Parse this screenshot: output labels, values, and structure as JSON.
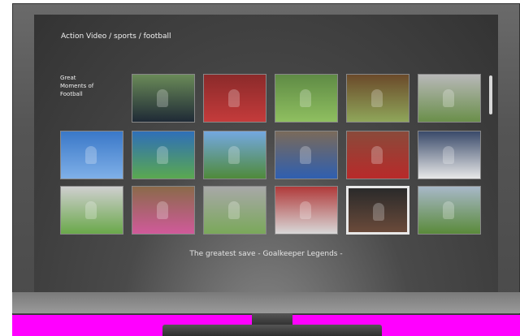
{
  "screen": {
    "breadcrumb": "Action Video / sports / football",
    "category_label": "Great\nMoments of\nFootball",
    "caption": "The greatest save - Goalkeeper Legends -"
  },
  "colors": {
    "pink_band": "#ff00ff",
    "bezel": "#555555"
  },
  "grid": {
    "selected_index": 15,
    "tiles": [
      {
        "icon": "stadium-crowd-photo",
        "top": "#6a8a58",
        "bottom": "#1f2a36"
      },
      {
        "icon": "team-celebration-red-photo",
        "top": "#8b2a2a",
        "bottom": "#c43b3b"
      },
      {
        "icon": "players-legs-field-photo",
        "top": "#5f8b45",
        "bottom": "#8fbf60"
      },
      {
        "icon": "slide-tackle-photo",
        "top": "#6b4a2a",
        "bottom": "#8fa65a"
      },
      {
        "icon": "stadium-stands-photo",
        "top": "#b8b8b8",
        "bottom": "#6a8f4a"
      },
      {
        "icon": "header-player-sky-photo",
        "top": "#3a78c8",
        "bottom": "#7fb0e8"
      },
      {
        "icon": "goalkeeper-green-dive-photo",
        "top": "#2f6fb8",
        "bottom": "#5aa850"
      },
      {
        "icon": "overhead-kick-sky-photo",
        "top": "#74a8e0",
        "bottom": "#4f8a3a"
      },
      {
        "icon": "goalkeeper-blue-jersey-photo",
        "top": "#7a6a5a",
        "bottom": "#2f5fb0"
      },
      {
        "icon": "two-players-red-black-photo",
        "top": "#8a4a3a",
        "bottom": "#b82a2a"
      },
      {
        "icon": "players-white-celebrate-photo",
        "top": "#3a4a6a",
        "bottom": "#e8e8e8"
      },
      {
        "icon": "player-running-pitch-photo",
        "top": "#cfcfcf",
        "bottom": "#6aa84a"
      },
      {
        "icon": "goalkeeper-pink-save-photo",
        "top": "#8a6a4a",
        "bottom": "#d05a9a"
      },
      {
        "icon": "goalkeeper-in-goal-photo",
        "top": "#a8a8a8",
        "bottom": "#7aa85a"
      },
      {
        "icon": "goal-net-stadium-photo",
        "top": "#b03a3a",
        "bottom": "#d8d8d8"
      },
      {
        "icon": "goalkeeper-night-punch-photo",
        "top": "#2a2a2a",
        "bottom": "#6a4a3a"
      },
      {
        "icon": "team-photo-white-photo",
        "top": "#a8b8c8",
        "bottom": "#5a8a3a"
      }
    ]
  }
}
